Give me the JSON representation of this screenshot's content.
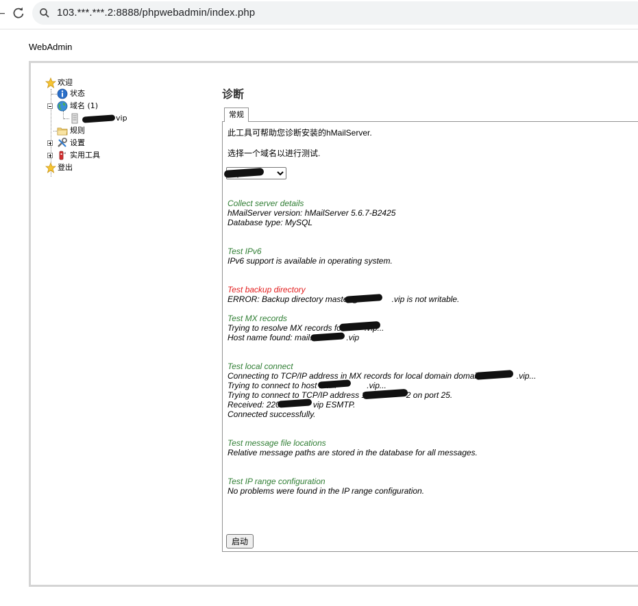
{
  "browser": {
    "url": "103.***.***.2:8888/phpwebadmin/index.php"
  },
  "app_title": "WebAdmin",
  "tree": {
    "welcome": "欢迎",
    "status": "状态",
    "domains": "域名 (1)",
    "domain_item": "vip",
    "rules": "规则",
    "settings": "设置",
    "utilities": "实用工具",
    "logout": "登出"
  },
  "page": {
    "title": "诊断",
    "tab": "常规",
    "intro": "此工具可帮助您诊断安装的hMailServer.",
    "choose_domain": "选择一个域名以进行测试.",
    "selected_domain": "vip",
    "start_button": "启动"
  },
  "results": {
    "collect": {
      "title": "Collect server details",
      "line1": "hMailServer version: hMailServer 5.6.7-B2425",
      "line2": "Database type: MySQL"
    },
    "ipv6": {
      "title": "Test IPv6",
      "line1": "IPv6 support is available in operating system."
    },
    "backup": {
      "title": "Test backup directory",
      "line1_a": "ERROR: Backup directory master@",
      "line1_b": ".vip is not writable."
    },
    "mx": {
      "title": "Test MX records",
      "line1_a": "Trying to resolve MX records for",
      "line1_b": ".vip...",
      "line2_a": "Host name found: mail.",
      "line2_b": ".vip"
    },
    "local": {
      "title": "Test local connect",
      "line1_a": "Connecting to TCP/IP address in MX records for local domain domain",
      "line1_b": ".vip...",
      "line2_a": "Trying to connect to host mail.",
      "line2_b": ".vip...",
      "line3_a": "Trying to connect to TCP/IP address 103.",
      "line3_b": "2 on port 25.",
      "line4_a": "Received: 220",
      "line4_b": "vip ESMTP.",
      "line5": "Connected successfully."
    },
    "locations": {
      "title": "Test message file locations",
      "line1": "Relative message paths are stored in the database for all messages."
    },
    "iprange": {
      "title": "Test IP range configuration",
      "line1": "No problems were found in the IP range configuration."
    }
  },
  "colors": {
    "ok_heading": "#2e7d32",
    "error": "#e21c1c",
    "frame_border": "#d4d4d4"
  },
  "icons": [
    "reload-icon",
    "search-icon",
    "star-icon",
    "info-icon",
    "globe-icon",
    "server-icon",
    "folder-icon",
    "tools-icon",
    "utilities-icon"
  ]
}
